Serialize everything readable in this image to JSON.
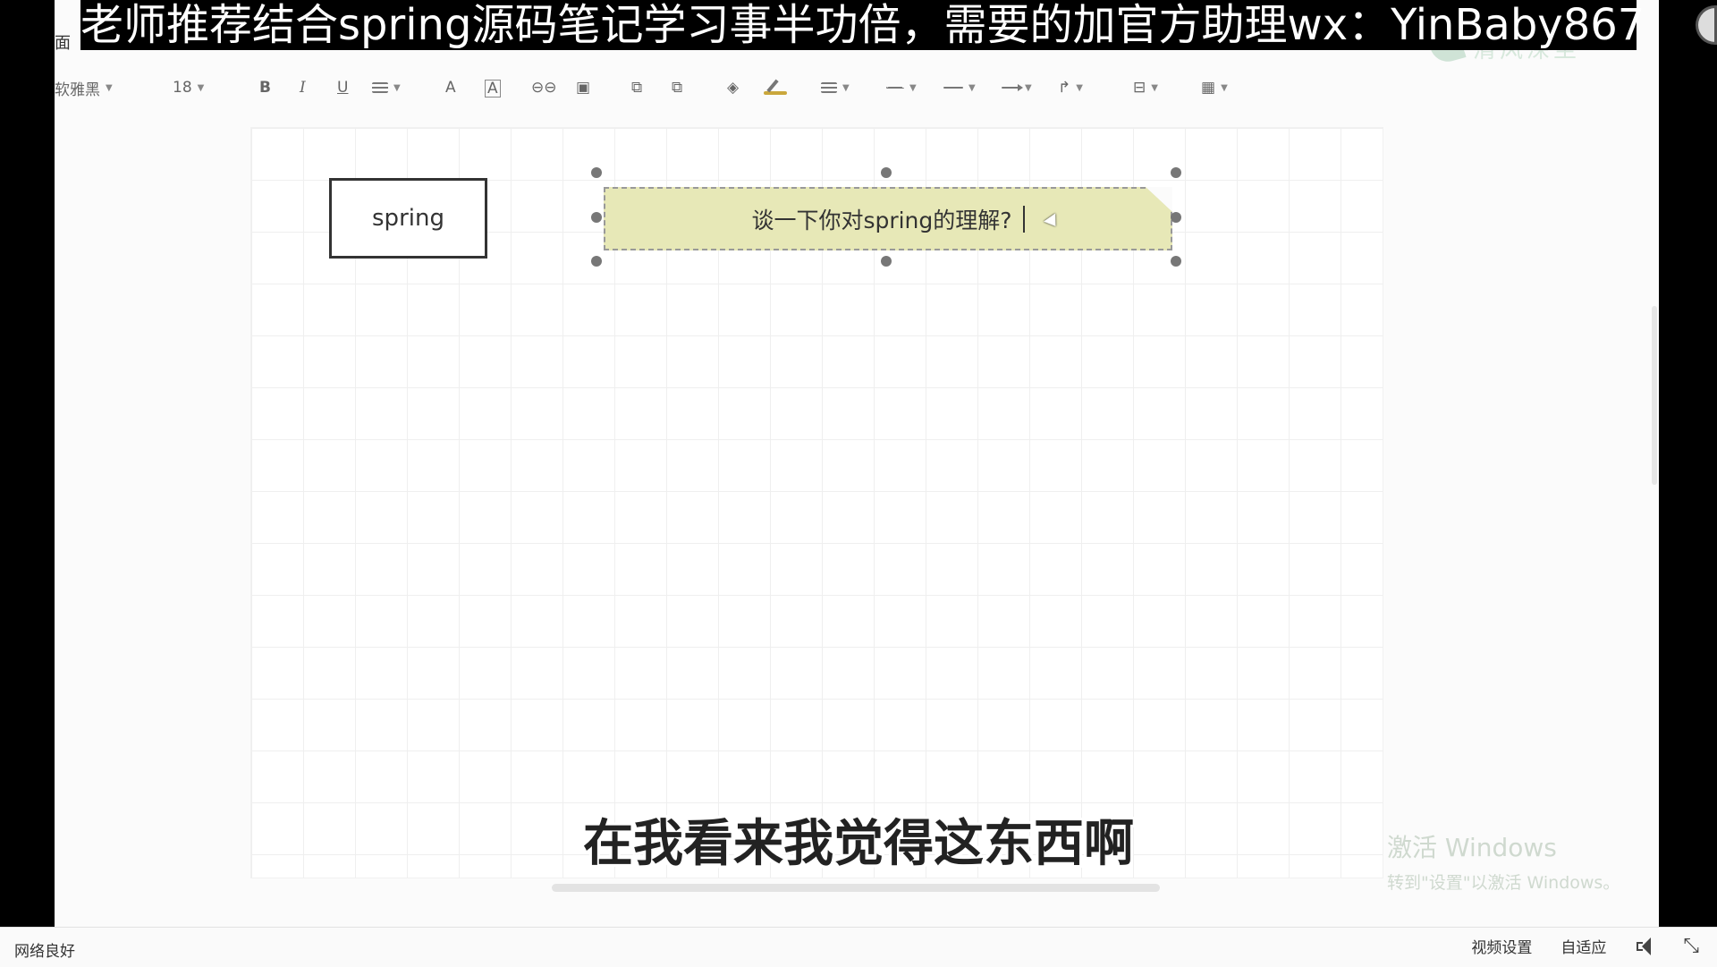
{
  "banner": {
    "text": "老师推荐结合spring源码笔记学习事半功倍，需要的加官方助理wx：YinBaby867"
  },
  "menubar": {
    "item": "面",
    "logo_text": "清风深至"
  },
  "toolbar": {
    "font_name": "软雅黑",
    "font_size": "18",
    "bold": "B",
    "italic": "I",
    "underline": "U",
    "font_color": "A",
    "bg_color": "A",
    "link_glyph": "⊖⊖",
    "image_glyph": "▣",
    "group_glyph": "⧉",
    "ungroup_glyph": "⧉",
    "fill_glyph": "◈",
    "connector_glyph": "↱",
    "position_glyph": "⊟",
    "table_glyph": "▦"
  },
  "canvas": {
    "node_spring": "spring",
    "note_text": "谈一下你对spring的理解?"
  },
  "watermark": {
    "line1": "激活 Windows",
    "line2": "转到\"设置\"以激活 Windows。"
  },
  "subtitle": {
    "text": "在我看来我觉得这东西啊"
  },
  "player": {
    "network": "网络良好",
    "video_settings": "视频设置",
    "adaptive": "自适应",
    "shrink_glyph": "⤡"
  }
}
